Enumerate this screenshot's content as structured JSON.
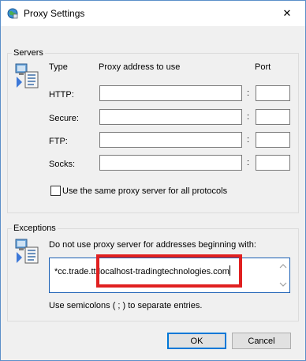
{
  "window": {
    "title": "Proxy Settings",
    "icon": "globe-network-icon",
    "close_glyph": "✕"
  },
  "servers": {
    "legend": "Servers",
    "icon": "network-computer-icon",
    "col_type": "Type",
    "col_address": "Proxy address to use",
    "col_port": "Port",
    "rows": [
      {
        "type": "HTTP:",
        "address": "",
        "port": ""
      },
      {
        "type": "Secure:",
        "address": "",
        "port": ""
      },
      {
        "type": "FTP:",
        "address": "",
        "port": ""
      },
      {
        "type": "Socks:",
        "address": "",
        "port": ""
      }
    ],
    "separator": ":",
    "same_proxy_label": "Use the same proxy server for all protocols",
    "same_proxy_checked": false
  },
  "exceptions": {
    "legend": "Exceptions",
    "icon": "network-computer-icon",
    "description": "Do not use proxy server for addresses beginning with:",
    "value": "*cc.trade.tt;localhost-tradingtechnologies.com",
    "hint": "Use semicolons ( ; ) to separate entries."
  },
  "buttons": {
    "ok": "OK",
    "cancel": "Cancel"
  },
  "colors": {
    "highlight": "#e02020",
    "accent": "#0078d7"
  }
}
